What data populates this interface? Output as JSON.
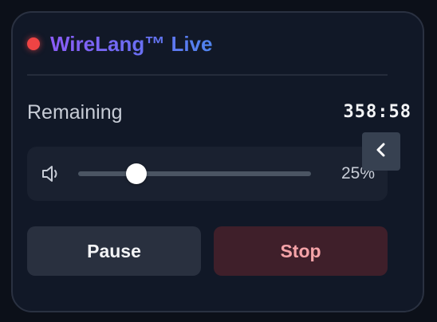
{
  "header": {
    "title": "WireLang™ Live",
    "live_indicator_color": "#ef4444"
  },
  "timer": {
    "label": "Remaining",
    "value": "358:58"
  },
  "collapse_button": {
    "icon": "chevron-left-icon"
  },
  "volume": {
    "icon": "speaker-icon",
    "value_label": "25%",
    "level": 0.25
  },
  "actions": {
    "pause_label": "Pause",
    "stop_label": "Stop"
  },
  "colors": {
    "title_gradient_start": "#8b5cf6",
    "title_gradient_end": "#4f84ee",
    "stop_text": "#f5a3a8"
  }
}
